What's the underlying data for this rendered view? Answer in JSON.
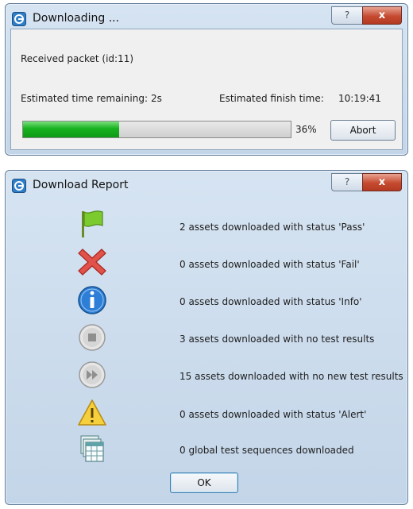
{
  "downloading_window": {
    "title": "Downloading ...",
    "help_label": "?",
    "close_label": "x",
    "status": "Received packet (id:11)",
    "time_remaining_label": "Estimated time remaining:",
    "time_remaining_value": "2s",
    "finish_time_label": "Estimated finish time:",
    "finish_time_value": "10:19:41",
    "progress_percent": 36,
    "progress_text": "36%",
    "abort_label": "Abort",
    "accent_color": "#17b11f"
  },
  "report_window": {
    "title": "Download Report",
    "help_label": "?",
    "close_label": "x",
    "rows": [
      {
        "icon": "green-flag-icon",
        "text": "2 assets downloaded with status 'Pass'"
      },
      {
        "icon": "red-x-icon",
        "text": "0 assets downloaded with status 'Fail'"
      },
      {
        "icon": "info-icon",
        "text": "0 assets downloaded with status 'Info'"
      },
      {
        "icon": "stop-icon",
        "text": "3 assets downloaded with no test results"
      },
      {
        "icon": "fast-forward-icon",
        "text": "15 assets downloaded with no new test results"
      },
      {
        "icon": "warning-icon",
        "text": "0 assets downloaded with status 'Alert'"
      },
      {
        "icon": "sequence-table-icon",
        "text": "0 global test sequences downloaded"
      }
    ],
    "ok_label": "OK"
  }
}
